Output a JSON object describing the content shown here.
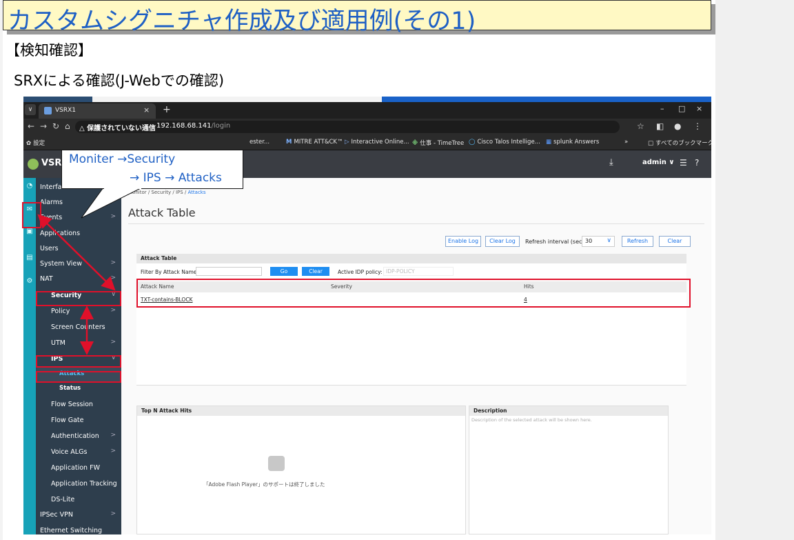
{
  "slide": {
    "title": "カスタムシグニチャ作成及び適用例(その1)",
    "section": "【検知確認】",
    "subtitle": "SRXによる確認(J-Webでの確認)"
  },
  "browser": {
    "tab_title": "VSRX1",
    "new_tab": "+",
    "security_warning": "△ 保護されていない通信",
    "url_host": "192.168.68.141",
    "url_path": "/login",
    "bookmarks": [
      "設定",
      "ester...",
      "MITRE ATT&CK™",
      "Interactive Online...",
      "仕事 - TimeTree",
      "Cisco Talos Intellige...",
      "splunk Answers",
      "»",
      "すべてのブックマーク"
    ]
  },
  "app": {
    "logo": "VSRX",
    "user": "admin ∨"
  },
  "sidebar": {
    "items": [
      {
        "label": "Interfaces",
        "chev": ""
      },
      {
        "label": "Alarms",
        "chev": ">"
      },
      {
        "label": "Events",
        "chev": ">"
      },
      {
        "label": "Applications",
        "chev": ""
      },
      {
        "label": "Users",
        "chev": ""
      },
      {
        "label": "System View",
        "chev": ">"
      },
      {
        "label": "NAT",
        "chev": ">"
      },
      {
        "label": "Security",
        "chev": "∨"
      },
      {
        "label": "Policy",
        "chev": ">"
      },
      {
        "label": "Screen Counters",
        "chev": ""
      },
      {
        "label": "UTM",
        "chev": ">"
      },
      {
        "label": "IPS",
        "chev": "∨"
      },
      {
        "label": "Attacks",
        "chev": ""
      },
      {
        "label": "Status",
        "chev": ""
      },
      {
        "label": "Flow Session",
        "chev": ""
      },
      {
        "label": "Flow Gate",
        "chev": ""
      },
      {
        "label": "Authentication",
        "chev": ">"
      },
      {
        "label": "Voice ALGs",
        "chev": ">"
      },
      {
        "label": "Application FW",
        "chev": ""
      },
      {
        "label": "Application Tracking",
        "chev": ""
      },
      {
        "label": "DS-Lite",
        "chev": ""
      },
      {
        "label": "IPSec VPN",
        "chev": ">"
      },
      {
        "label": "Ethernet Switching",
        "chev": ""
      }
    ]
  },
  "content": {
    "breadcrumb_prefix": "Monitor / Security / IPS / ",
    "breadcrumb_current": "Attacks",
    "page_title": "Attack Table",
    "toolbar": {
      "enable_log": "Enable Log",
      "clear_log": "Clear Log",
      "refresh_interval_label": "Refresh interval (sec)",
      "refresh_interval_value": "30",
      "refresh": "Refresh",
      "clear": "Clear"
    },
    "table": {
      "section_title": "Attack Table",
      "filter_label": "Filter By Attack Name",
      "go": "Go",
      "clear": "Clear",
      "policy_label": "Active IDP policy:",
      "policy_value": "IDP-POLICY",
      "columns": [
        "Attack Name",
        "Severity",
        "Hits"
      ],
      "rows": [
        [
          "TXT-contains-BLOCK",
          "",
          "4"
        ]
      ]
    },
    "topn_title": "Top N Attack Hits",
    "flash_msg": "「Adobe Flash Player」のサポートは終了しました",
    "desc_title": "Description",
    "desc_text": "Description of the selected attack will be shown here."
  },
  "callout": {
    "line1": "Moniter →Security",
    "line2": "→  IPS  →  Attacks"
  },
  "colors": {
    "title_blue": "#1f60c4",
    "title_bg": "#fff9c4",
    "highlight_red": "#e0102a",
    "sidebar_bg": "#2e3e4d",
    "strip_teal": "#17a2b8",
    "jweb_blue": "#1f8ef1"
  }
}
